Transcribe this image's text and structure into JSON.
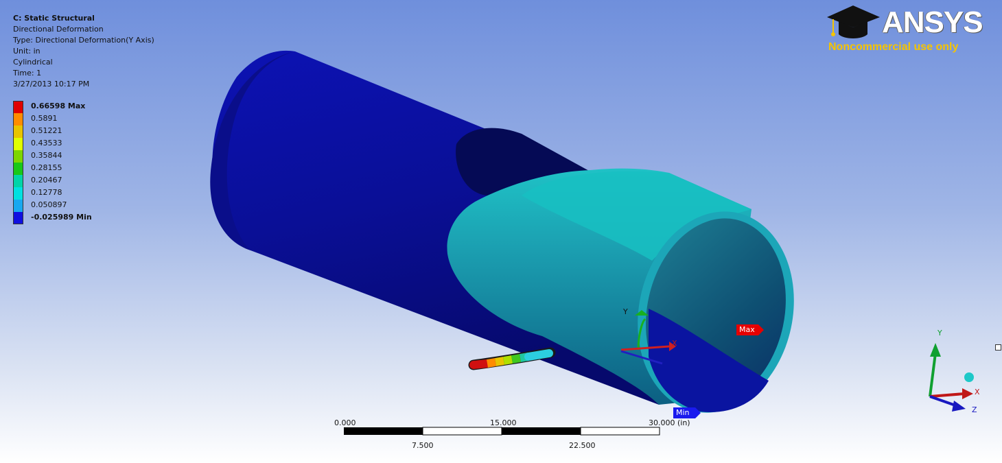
{
  "info": {
    "title": "C: Static Structural",
    "result": "Directional Deformation",
    "type": "Type: Directional Deformation(Y Axis)",
    "unit": "Unit: in",
    "system": "Cylindrical",
    "time": "Time: 1",
    "date": "3/27/2013 10:17 PM"
  },
  "legend": [
    {
      "label": "0.66598 Max",
      "color": "#e00000",
      "bold": true
    },
    {
      "label": "0.5891",
      "color": "#ff8c00",
      "bold": false
    },
    {
      "label": "0.51221",
      "color": "#e8c400",
      "bold": false
    },
    {
      "label": "0.43533",
      "color": "#e0ff00",
      "bold": false
    },
    {
      "label": "0.35844",
      "color": "#7dd600",
      "bold": false
    },
    {
      "label": "0.28155",
      "color": "#18c818",
      "bold": false
    },
    {
      "label": "0.20467",
      "color": "#00d4a8",
      "bold": false
    },
    {
      "label": "0.12778",
      "color": "#00e0e0",
      "bold": false
    },
    {
      "label": "0.050897",
      "color": "#18a8f0",
      "bold": false
    },
    {
      "label": "-0.025989 Min",
      "color": "#1010e0",
      "bold": true
    }
  ],
  "logo": {
    "brand": "ANSYS",
    "subtitle": "Noncommercial use only",
    "subtitle_color": "#f5c400"
  },
  "probes": {
    "max": "Max",
    "min": "Min"
  },
  "scale_bar": {
    "top_labels": [
      "0.000",
      "15.000",
      "30.000 (in)"
    ],
    "bottom_labels": [
      "7.500",
      "22.500"
    ]
  },
  "triad": {
    "x": "X",
    "y": "Y",
    "z": "Z"
  },
  "colors": {
    "outer_pipe": "#0b0f98",
    "inner_pipe": "#1f8fa0",
    "inner_pipe_top": "#16bcc0",
    "background_top": "#6f8fdc"
  }
}
